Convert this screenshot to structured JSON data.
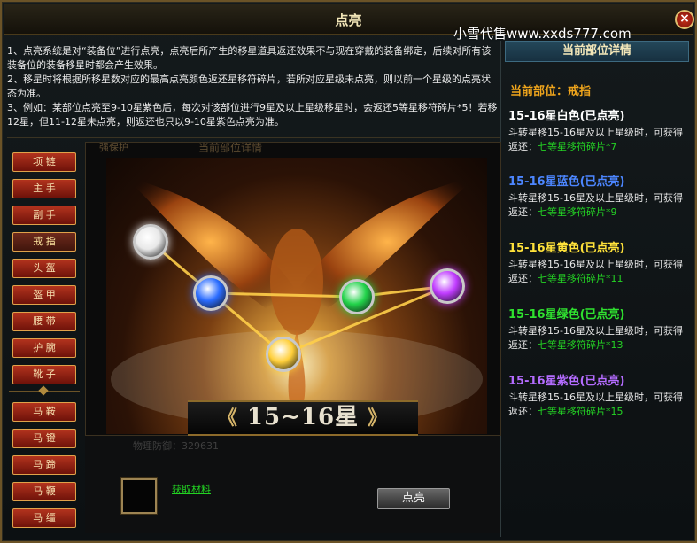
{
  "window": {
    "title": "点亮",
    "watermark": "小雪代售www.xxds777.com",
    "close_glyph": "×"
  },
  "description": [
    "1、点亮系统是对“装备位”进行点亮，点亮后所产生的移星道具返还效果不与现在穿戴的装备绑定，后续对所有该装备位的装备移星时都会产生效果。",
    "2、移星时将根据所移星数对应的最高点亮颜色返还星移符碎片，若所对应星级未点亮，则以前一个星级的点亮状态为准。",
    "3、例如：某部位点亮至9-10星紫色后，每次对该部位进行9星及以上星级移星时，会返还5等星移符碎片*5！若移12星，但11-12星未点亮，则返还也只以9-10星紫色点亮为准。"
  ],
  "background_ghost": {
    "tab_left": "强保护",
    "tab_center": "当前部位详情",
    "stat": "物理防御：329631"
  },
  "sidebar": {
    "items": [
      {
        "label": "项 链"
      },
      {
        "label": "主 手"
      },
      {
        "label": "副 手"
      },
      {
        "label": "戒 指",
        "active": true
      },
      {
        "label": "头 盔"
      },
      {
        "label": "盔 甲"
      },
      {
        "label": "腰 带"
      },
      {
        "label": "护 腕"
      },
      {
        "label": "靴 子"
      },
      {
        "label": "马 鞍"
      },
      {
        "label": "马 镫"
      },
      {
        "label": "马 蹄"
      },
      {
        "label": "马 鞭"
      },
      {
        "label": "马 缰"
      }
    ]
  },
  "banner": {
    "left_arrow": "《",
    "text": "15~16星",
    "right_arrow": "》"
  },
  "orbs": [
    {
      "name": "white-orb",
      "color": "#e8e8e8",
      "lit": true
    },
    {
      "name": "blue-orb",
      "color": "#2a6cff",
      "lit": true
    },
    {
      "name": "yellow-orb",
      "color": "#ffcf3a",
      "lit": true
    },
    {
      "name": "green-orb",
      "color": "#22d34a",
      "lit": true
    },
    {
      "name": "purple-orb",
      "color": "#c03cff",
      "lit": true
    }
  ],
  "bottom": {
    "material_link": "获取材料",
    "light_button": "点亮"
  },
  "detail": {
    "header": "当前部位详情",
    "current_part": "当前部位：戒指",
    "tiers": [
      {
        "title": "15-16星白色(已点亮)",
        "color": "#ffffff",
        "desc": "斗转星移15-16星及以上星级时，可获得返还：",
        "reward": "七等星移符碎片*7"
      },
      {
        "title": "15-16星蓝色(已点亮)",
        "color": "#4c86ff",
        "desc": "斗转星移15-16星及以上星级时，可获得返还：",
        "reward": "七等星移符碎片*9"
      },
      {
        "title": "15-16星黄色(已点亮)",
        "color": "#ffe23a",
        "desc": "斗转星移15-16星及以上星级时，可获得返还：",
        "reward": "七等星移符碎片*11"
      },
      {
        "title": "15-16星绿色(已点亮)",
        "color": "#2fe02f",
        "desc": "斗转星移15-16星及以上星级时，可获得返还：",
        "reward": "七等星移符碎片*13"
      },
      {
        "title": "15-16星紫色(已点亮)",
        "color": "#b46cff",
        "desc": "斗转星移15-16星及以上星级时，可获得返还：",
        "reward": "七等星移符碎片*15"
      }
    ]
  }
}
